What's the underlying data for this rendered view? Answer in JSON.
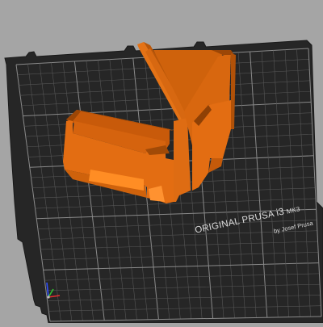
{
  "viewport": {
    "background": "#a5a5a5",
    "bed_color": "#252525",
    "grid_color": "#5d5d5d",
    "model_color": "#e36d12"
  },
  "bed": {
    "brand_line1": "ORIGINAL PRUSA",
    "brand_model": "i3",
    "brand_suffix": "MK3",
    "brand_line2": "by Josef Prusa"
  },
  "axes": {
    "x_color": "#e03030",
    "y_color": "#30c030",
    "z_color": "#3050ff"
  }
}
